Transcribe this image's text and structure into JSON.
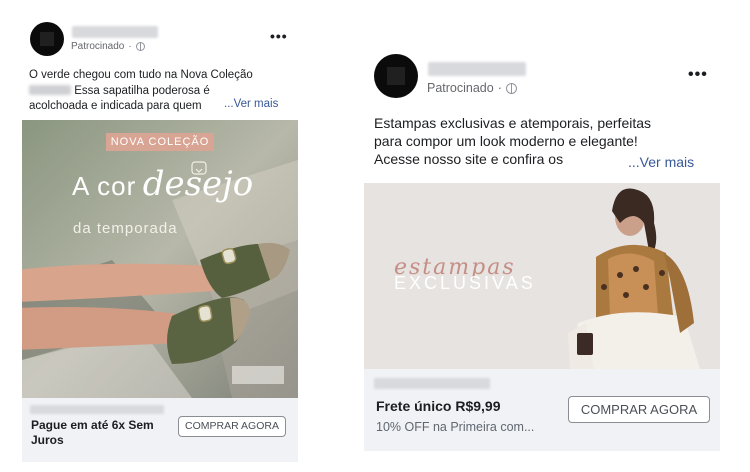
{
  "ad_left": {
    "sponsored_label": "Patrocinado",
    "more_icon": "more-options-icon",
    "privacy_icon": "globe-icon",
    "text_line1": "O verde chegou com tudo na Nova Coleção",
    "text_line2": "Essa sapatilha poderosa é",
    "text_line3": "acolchoada e indicada para quem",
    "see_more": "...Ver mais",
    "creative": {
      "badge": "NOVA COLEÇÃO",
      "headline_part1": "A cor",
      "headline_script": "desejo",
      "headline_part2": "da temporada"
    },
    "footer": {
      "headline": "Pague em até 6x Sem Juros",
      "cta": "COMPRAR AGORA"
    }
  },
  "ad_right": {
    "sponsored_label": "Patrocinado",
    "more_icon": "more-options-icon",
    "privacy_icon": "globe-icon",
    "text_line1": "Estampas exclusivas e atemporais, perfeitas",
    "text_line2": "para compor um look moderno e elegante!",
    "text_line3": "Acesse nosso site e confira os",
    "see_more": "...Ver mais",
    "creative": {
      "script_text": "estampas",
      "caps_text": "EXCLUSIVAS"
    },
    "footer": {
      "headline": "Frete único R$9,99",
      "description": "10% OFF na Primeira com...",
      "cta": "COMPRAR AGORA"
    }
  }
}
